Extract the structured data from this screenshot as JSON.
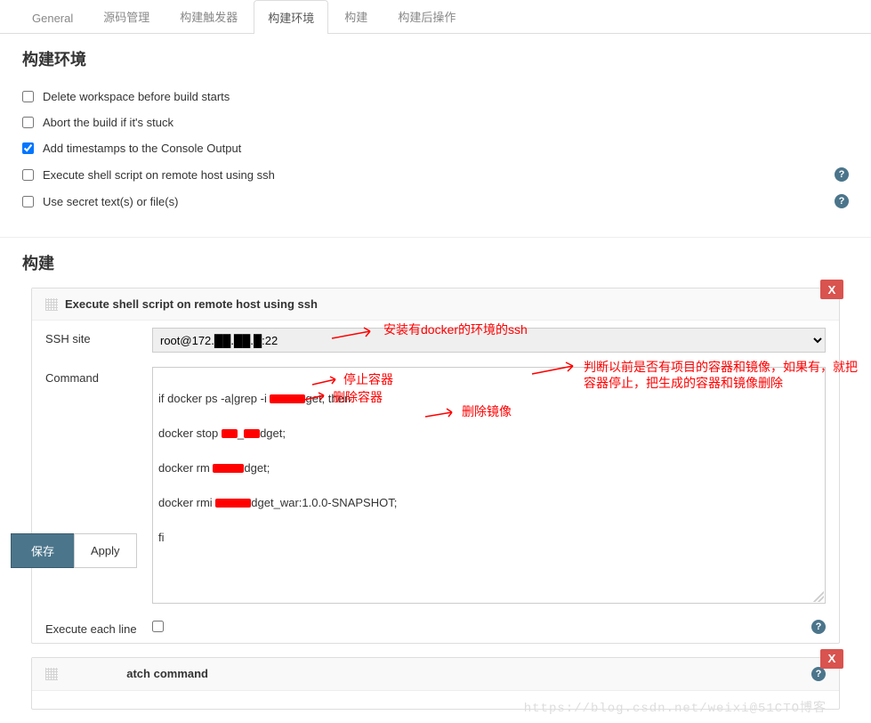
{
  "tabs": [
    {
      "label": "General"
    },
    {
      "label": "源码管理"
    },
    {
      "label": "构建触发器"
    },
    {
      "label": "构建环境"
    },
    {
      "label": "构建"
    },
    {
      "label": "构建后操作"
    }
  ],
  "active_tab_index": 3,
  "build_env": {
    "title": "构建环境",
    "options": [
      {
        "label": "Delete workspace before build starts",
        "checked": false,
        "help": false
      },
      {
        "label": "Abort the build if it's stuck",
        "checked": false,
        "help": false
      },
      {
        "label": "Add timestamps to the Console Output",
        "checked": true,
        "help": false
      },
      {
        "label": "Execute shell script on remote host using ssh",
        "checked": false,
        "help": true
      },
      {
        "label": "Use secret text(s) or file(s)",
        "checked": false,
        "help": true
      }
    ]
  },
  "build": {
    "title": "构建",
    "step1": {
      "title": "Execute shell script on remote host using ssh",
      "ssh_label": "SSH site",
      "ssh_value": "root@172.██.██.█:22",
      "command_label": "Command",
      "command_lines": [
        "if docker ps -a|grep -i ███dget; then",
        "docker stop ██_██dget;",
        "docker rm ██_██dget;",
        "docker rmi ███dget_war:1.0.0-SNAPSHOT;",
        "fi"
      ],
      "exec_each_label": "Execute each line",
      "exec_each_checked": false,
      "delete_label": "X"
    },
    "step2": {
      "title_fragment": "atch command",
      "delete_label": "X"
    }
  },
  "annotations": {
    "ssh_desc": "安装有docker的环境的ssh",
    "judge_line1": "判断以前是否有项目的容器和镜像，如果有，就把",
    "judge_line2": "容器停止，把生成的容器和镜像删除",
    "stop_container": "停止容器",
    "rm_container": "删除容器",
    "rm_image": "删除镜像"
  },
  "buttons": {
    "save": "保存",
    "apply": "Apply"
  },
  "watermark": "https://blog.csdn.net/weixi@51CTO博客"
}
